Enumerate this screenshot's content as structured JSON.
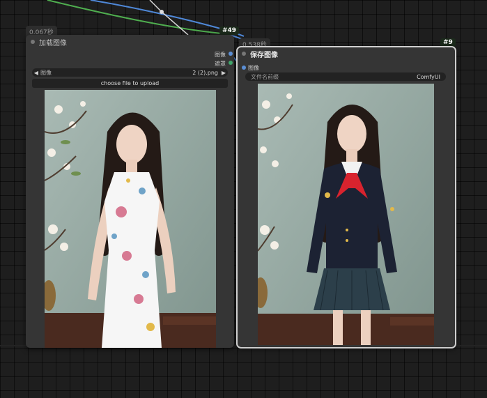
{
  "load_node": {
    "time": "0.067秒",
    "title": "加载图像",
    "outputs": [
      "图像",
      "遮罩"
    ],
    "image_widget": {
      "label": "图像",
      "value": "2 (2).png"
    },
    "upload_button": "choose file to upload",
    "output_colors": [
      "#5b8fd6",
      "#3fa66b"
    ]
  },
  "save_node": {
    "time": "0.538秒",
    "id": "#9",
    "title": "保存图像",
    "inputs": [
      "图像"
    ],
    "prefix_widget": {
      "label": "文件名前缀",
      "value": "ComfyUI"
    }
  },
  "link_badge": "#49"
}
